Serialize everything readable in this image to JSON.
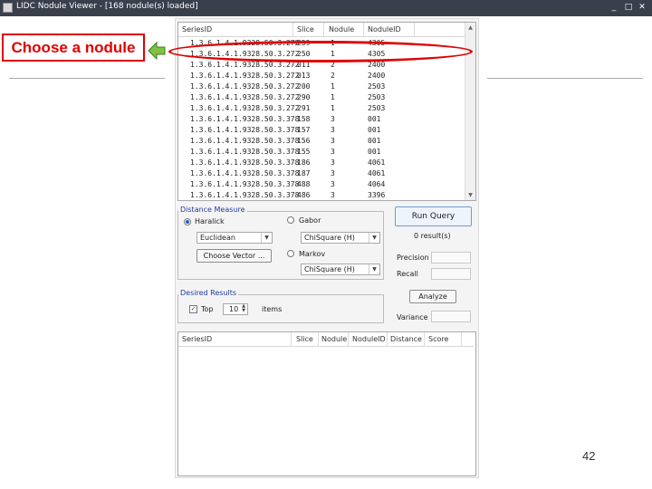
{
  "window": {
    "title": "LIDC Nodule Viewer - [168 nodule(s) loaded]",
    "minimize": "_",
    "maximize": "□",
    "close": "✕"
  },
  "annotation": {
    "callout": "Choose a nodule",
    "page_number": "42",
    "highlight_color": "#e00000"
  },
  "nodule_table": {
    "columns": [
      "SeriesID",
      "Slice",
      "Nodule",
      "NoduleID"
    ],
    "rows": [
      [
        "1.3.6.1.4.1.9328.50.3.272",
        "259",
        "1",
        "4305"
      ],
      [
        "1.3.6.1.4.1.9328.50.3.272",
        "250",
        "1",
        "4305"
      ],
      [
        "1.3.6.1.4.1.9328.50.3.272",
        "011",
        "2",
        "2400"
      ],
      [
        "1.3.6.1.4.1.9328.50.3.272",
        "013",
        "2",
        "2400"
      ],
      [
        "1.3.6.1.4.1.9328.50.3.272",
        "200",
        "1",
        "2503"
      ],
      [
        "1.3.6.1.4.1.9328.50.3.272",
        "290",
        "1",
        "2503"
      ],
      [
        "1.3.6.1.4.1.9328.50.3.272",
        "291",
        "1",
        "2503"
      ],
      [
        "1.3.6.1.4.1.9328.50.3.378",
        "158",
        "3",
        "001"
      ],
      [
        "1.3.6.1.4.1.9328.50.3.378",
        "157",
        "3",
        "001"
      ],
      [
        "1.3.6.1.4.1.9328.50.3.378",
        "156",
        "3",
        "001"
      ],
      [
        "1.3.6.1.4.1.9328.50.3.378",
        "155",
        "3",
        "001"
      ],
      [
        "1.3.6.1.4.1.9328.50.3.378",
        "186",
        "3",
        "4061"
      ],
      [
        "1.3.6.1.4.1.9328.50.3.378",
        "187",
        "3",
        "4061"
      ],
      [
        "1.3.6.1.4.1.9328.50.3.378",
        "488",
        "3",
        "4064"
      ],
      [
        "1.3.6.1.4.1.9328.50.3.378",
        "486",
        "3",
        "3396"
      ]
    ]
  },
  "distance_measure": {
    "legend": "Distance Measure",
    "options": [
      {
        "label": "Haralick",
        "selected": true,
        "select": "Euclidean",
        "button": "Choose Vector ..."
      },
      {
        "label": "Gabor",
        "selected": false,
        "select": "ChiSquare (H)"
      },
      {
        "label": "Markov",
        "selected": false,
        "select": "ChiSquare (H)"
      }
    ]
  },
  "query": {
    "run_label": "Run Query",
    "result_label": "0 result(s)",
    "precision_label": "Precision",
    "recall_label": "Recall",
    "analyze_label": "Analyze",
    "variance_label": "Variance"
  },
  "desired_results": {
    "legend": "Desired Results",
    "top_label": "Top",
    "top_checked": true,
    "top_value": "10",
    "items_label": "items"
  },
  "results_table": {
    "columns": [
      "SeriesID",
      "Slice",
      "Nodule",
      "NoduleID",
      "Distance",
      "Score"
    ]
  }
}
